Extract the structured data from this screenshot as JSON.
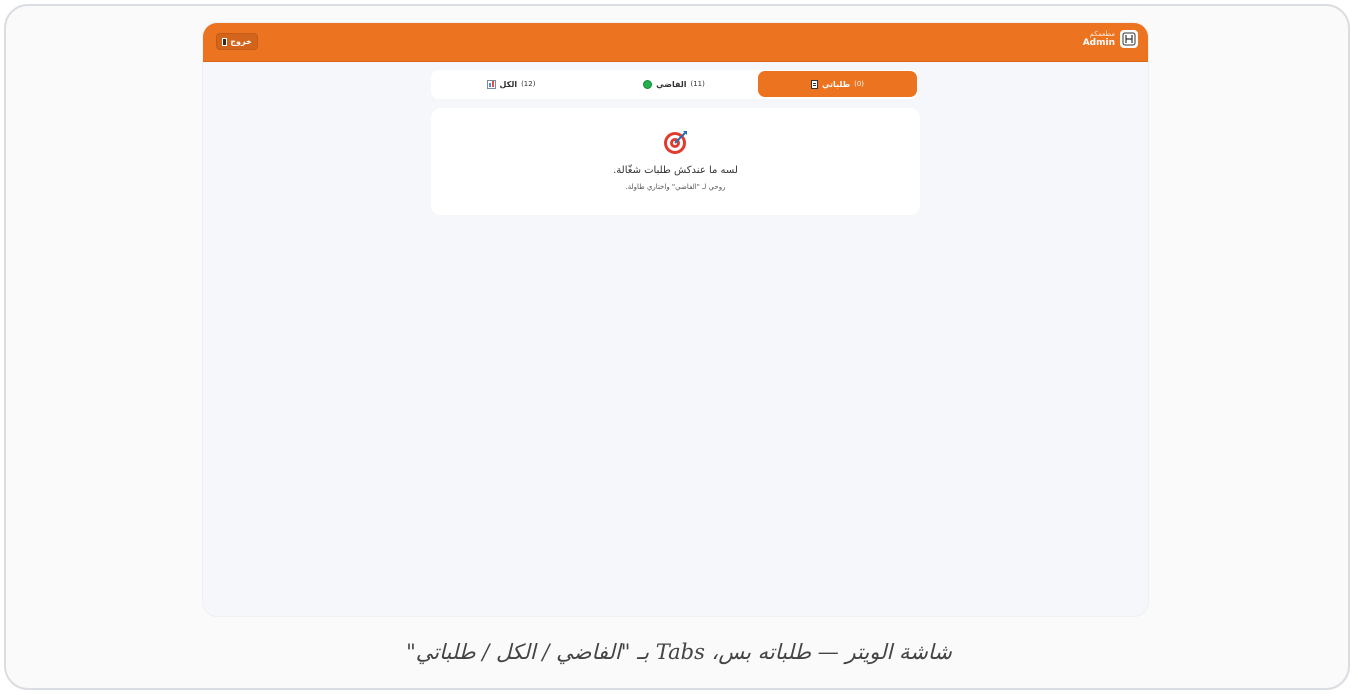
{
  "header": {
    "brand_name": "مطعمكم",
    "user": "Admin",
    "logout_label": "خروج",
    "accent": "#ec7320"
  },
  "tabs": [
    {
      "label": "طلباتي",
      "count": "(0)",
      "icon": "clipboard-icon",
      "active": true
    },
    {
      "label": "الفاضي",
      "count": "(11)",
      "icon": "green-circle-icon",
      "active": false
    },
    {
      "label": "الكل",
      "count": "(12)",
      "icon": "bar-chart-icon",
      "active": false
    }
  ],
  "empty_state": {
    "icon": "target-icon",
    "title": "لسه ما عندكش طلبات شغّالة.",
    "hint": "روحي لـ \"الفاضي\" واختاري طاولة."
  },
  "caption": "شاشة الويتر — طلباته بس، Tabs بـ \"الفاضي / الكل / طلباتي\""
}
